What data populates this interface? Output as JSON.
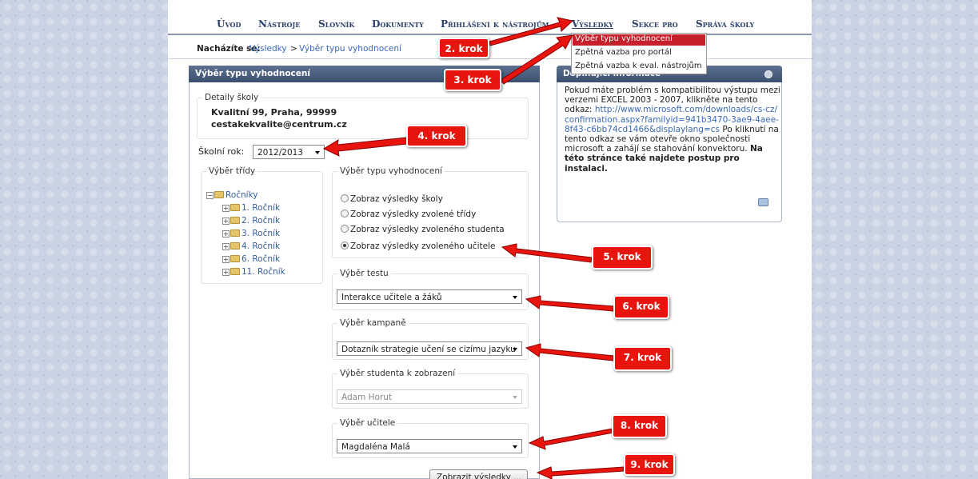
{
  "nav": [
    "Úvod",
    "Nástroje",
    "Slovník",
    "Dokumenty",
    "Přihlášení k nástrojům",
    "Výsledky",
    "Sekce pro",
    "Správa školy"
  ],
  "breadcrumb": {
    "label": "Nacházíte se:",
    "path1": "Výsledky",
    "sep": ">",
    "path2": "Výběr typu vyhodnocení"
  },
  "menu": [
    "Výběr typu vyhodnocení",
    "Zpětná vazba pro portál",
    "Zpětná vazba k eval. nástrojům"
  ],
  "main": {
    "title": "Výběr typu vyhodnocení",
    "school": {
      "legend": "Detaily školy",
      "address": "Kvalitní 99, Praha, 99999",
      "email": "cestakekvalite@centrum.cz"
    },
    "year_label": "Školní rok:",
    "year": "2012/2013",
    "class_legend": "Výběr třídy",
    "tree_root": "Ročníky",
    "tree": [
      "1. Ročník",
      "2. Ročník",
      "3. Ročník",
      "4. Ročník",
      "6. Ročník",
      "11. Ročník"
    ],
    "type_legend": "Výběr typu vyhodnocení",
    "radios": [
      "Zobraz výsledky školy",
      "Zobraz výsledky zvolené třídy",
      "Zobraz výsledky zvoleného studenta",
      "Zobraz výsledky zvoleného učitele"
    ],
    "test_legend": "Výběr testu",
    "test": "Interakce učitele a žáků",
    "campaign_legend": "Výběr kampaně",
    "campaign": "Dotazník strategie učení se cizímu jazyku",
    "student_legend": "Výběr studenta k zobrazení",
    "student": "Adam Horut",
    "teacher_legend": "Výběr učitele",
    "teacher": "Magdaléna Malá",
    "submit": "Zobrazit výsledky ..."
  },
  "side": {
    "title": "Doplňující informace",
    "text1": "Pokud máte problém s kompatibilitou výstupu mezi verzemi EXCEL 2003 - 2007, klikněte na tento odkaz: ",
    "link": "http://www.microsoft.com/downloads/cs-cz/confirmation.aspx?familyid=941b3470-3ae9-4aee-8f43-c6bb74cd1466&displaylang=cs",
    "text2": " Po kliknutí na tento odkaz se vám otevře okno společnosti microsoft a zahájí se stahování konvektoru. ",
    "bold": "Na této stránce také najdete postup pro instalaci."
  },
  "annotations": [
    "2. krok",
    "3. krok",
    "4. krok",
    "5. krok",
    "6. krok",
    "7. krok",
    "8. krok",
    "9. krok"
  ],
  "colors": {
    "accent": "#c8202a",
    "header": "#3b4f70",
    "callout": "#e8150f"
  }
}
